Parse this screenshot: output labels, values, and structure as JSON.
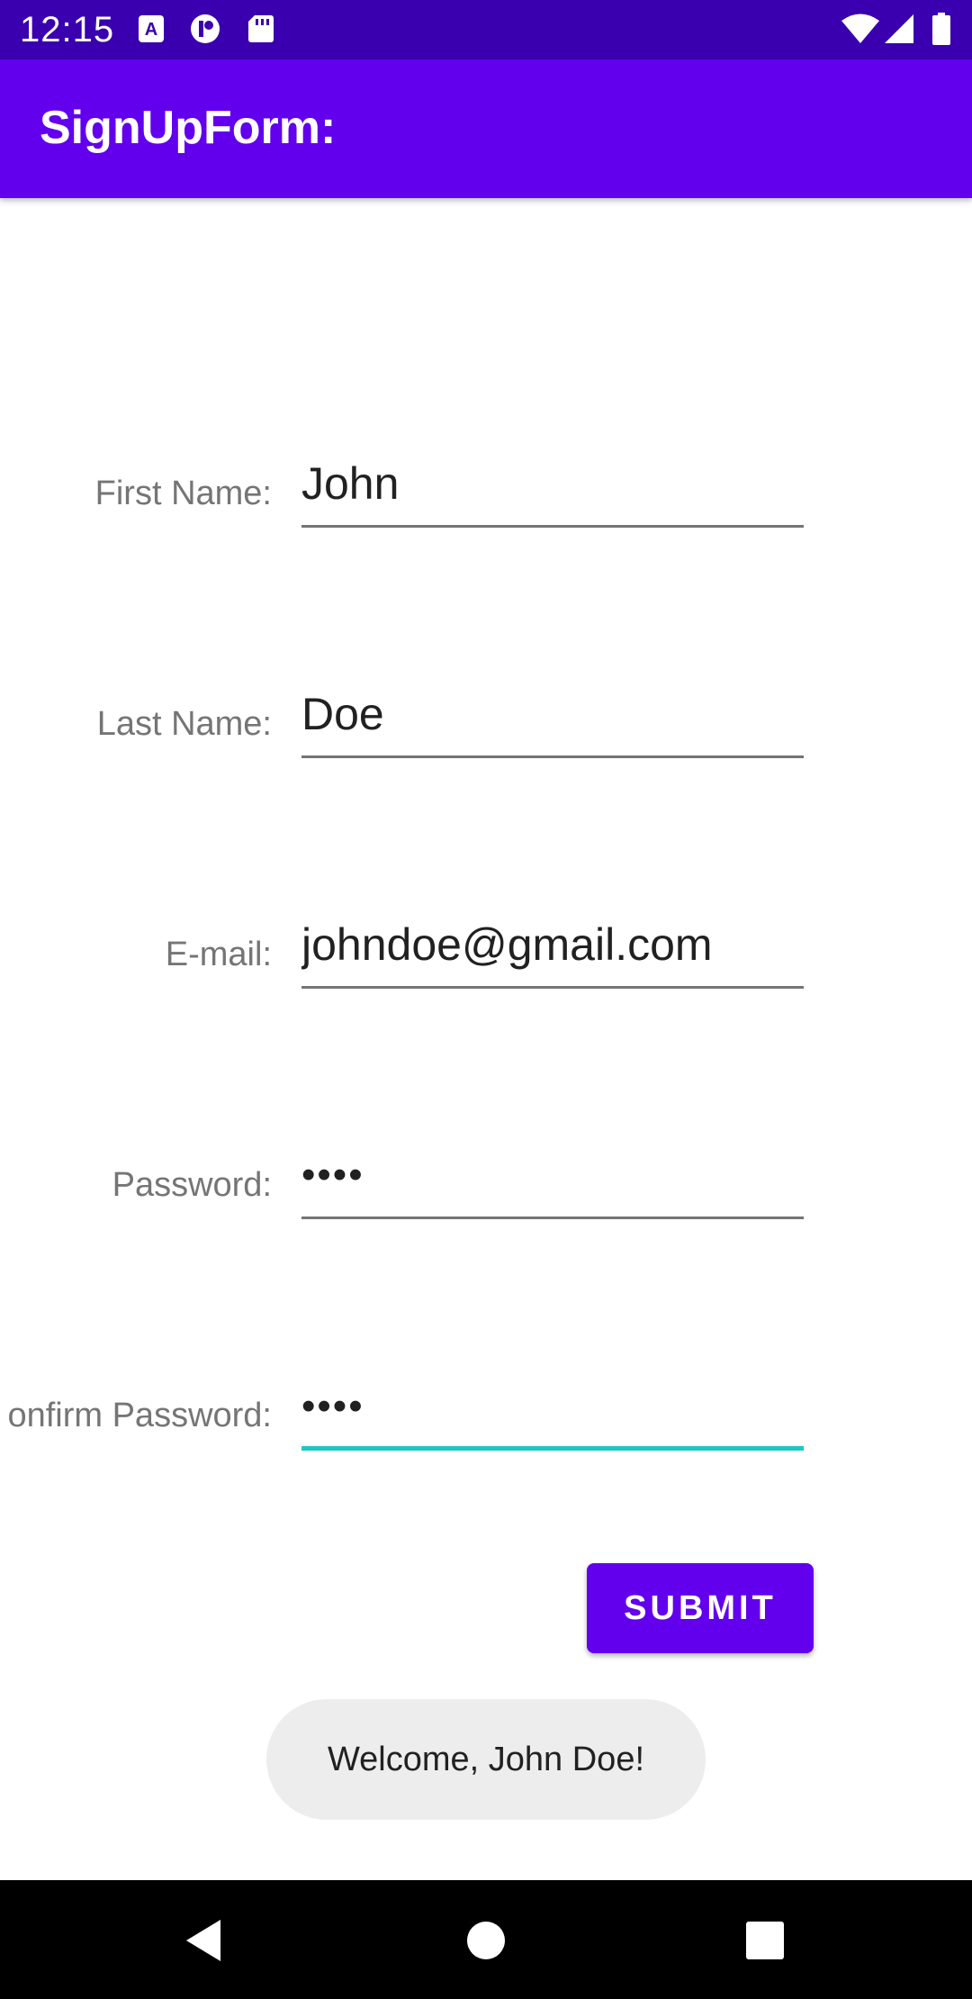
{
  "status_bar": {
    "time": "12:15",
    "left_icons": [
      "a-notification-icon",
      "p-notification-icon",
      "sd-card-icon"
    ],
    "right_icons": [
      "wifi-icon",
      "signal-icon",
      "battery-icon"
    ]
  },
  "app_bar": {
    "title": "SignUpForm:"
  },
  "form": {
    "first_name": {
      "label": "First Name:",
      "value": "John"
    },
    "last_name": {
      "label": "Last Name:",
      "value": "Doe"
    },
    "email": {
      "label": "E-mail:",
      "value": "johndoe@gmail.com"
    },
    "password": {
      "label": "Password:",
      "value": "••••"
    },
    "confirm_password": {
      "label": "onfirm Password:",
      "value": "••••",
      "focused": true
    },
    "submit_label": "SUBMIT"
  },
  "toast": {
    "message": "Welcome, John Doe!"
  },
  "nav_bar": {
    "buttons": [
      "back-icon",
      "home-icon",
      "recents-icon"
    ]
  },
  "colors": {
    "status_bar": "#3a00b0",
    "app_bar": "#6200ee",
    "accent": "#1ec8c0",
    "button": "#6200ee",
    "toast_bg": "#ededed"
  }
}
